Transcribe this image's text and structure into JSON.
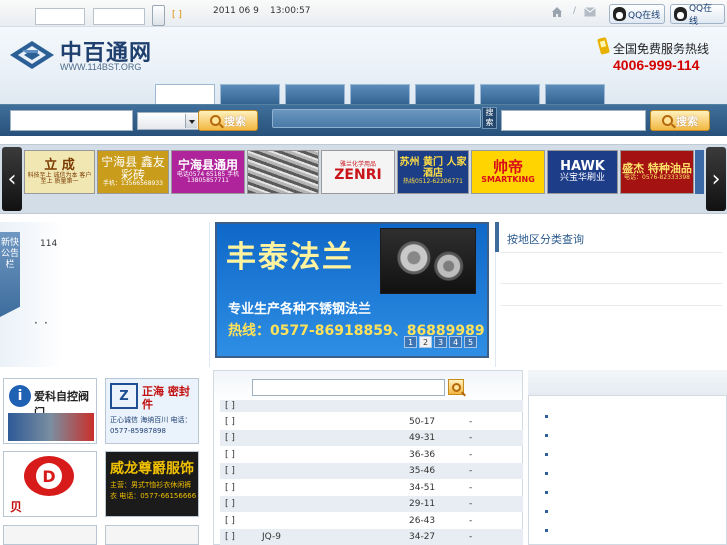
{
  "topbar": {
    "bracket": "[ ]",
    "date": "2011 06 9",
    "time": "13:00:57",
    "divider": "/",
    "qq1": "QQ在线",
    "qq2": "QQ在线"
  },
  "header": {
    "logo_title": "中百通网",
    "logo_url": "WWW.114BST.ORG",
    "hotline_label": "全国免费服务热线",
    "hotline_number": "4006-999-114"
  },
  "search": {
    "button_label": "搜索",
    "vertical_label": "搜索",
    "button2_label": "搜索"
  },
  "ads": [
    {
      "title": "立 成",
      "sub": "科技至上 诚信为本 客户至上 质量第一",
      "bg": "#f1e7b3",
      "fg": "#7a3a00"
    },
    {
      "title": "宁海县 鑫友彩砖",
      "sub": "手机：13566568933",
      "bg": "#c99d1b",
      "fg": "#ffffff"
    },
    {
      "title": "宁海县通用",
      "sub": "电话0574 65185 手机13805857711",
      "bg": "#b0249b",
      "fg": "#ffffff"
    },
    {
      "title": "",
      "sub": "",
      "bg": "#8b8b8b",
      "fg": "#ffffff"
    },
    {
      "title": "ZENRI",
      "sub": "雅兰化学用品",
      "bg": "#f4f4f4",
      "fg": "#c9141a"
    },
    {
      "title": "苏州 黄门 人家 酒店",
      "sub": "热线0512-62206771",
      "bg": "#1c3e87",
      "fg": "#ffdd44"
    },
    {
      "title": "帅帝",
      "sub": "SMARTKING",
      "bg": "#ffd400",
      "fg": "#d90c1a"
    },
    {
      "title": "HAWK",
      "sub": "兴宝华刷业",
      "bg": "#1d3d89",
      "fg": "#ffffff"
    },
    {
      "title": "盛杰 特种油品",
      "sub": "电话：0576-82333398",
      "bg": "#a41212",
      "fg": "#ffe26a"
    }
  ],
  "notice": {
    "flag_label": "新快公告栏",
    "item": "114",
    "dot": "·"
  },
  "banner": {
    "title": "丰泰法兰",
    "subtitle": "专业生产各种不锈钢法兰",
    "tel": "热线：0577-86918859、86889989",
    "pages": [
      "1",
      "2",
      "3",
      "4",
      "5"
    ]
  },
  "area": {
    "title": "按地区分类查询"
  },
  "bottom_ads": [
    {
      "title": "爱科自控阀门",
      "sub": ""
    },
    {
      "title": "正海 密封件",
      "sub": "正心诚信 海纳百川 电话：0577-85987898"
    },
    {
      "title": "贝 得",
      "sub": ""
    },
    {
      "title": "威龙尊爵服饰",
      "sub": "主营：男式T恤衫衣休闲裤衣 电话：0577-66156666"
    }
  ],
  "list_rows": [
    {
      "mark": "[ ]",
      "name": "",
      "num": "50-17",
      "dash": "-"
    },
    {
      "mark": "[ ]",
      "name": "",
      "num": "49-31",
      "dash": "-"
    },
    {
      "mark": "[ ]",
      "name": "",
      "num": "36-36",
      "dash": "-"
    },
    {
      "mark": "[ ]",
      "name": "",
      "num": "35-46",
      "dash": "-"
    },
    {
      "mark": "[ ]",
      "name": "",
      "num": "34-51",
      "dash": "-"
    },
    {
      "mark": "[ ]",
      "name": "",
      "num": "29-11",
      "dash": "-"
    },
    {
      "mark": "[ ]",
      "name": "",
      "num": "26-43",
      "dash": "-"
    },
    {
      "mark": "[ ]",
      "name": "JQ-9",
      "num": "34-27",
      "dash": "-"
    }
  ],
  "colors": {
    "nav_blue": "#2d5882",
    "hotline_red": "#d40000",
    "banner_blue": "#1a78d8",
    "search_orange": "#f2b741"
  }
}
